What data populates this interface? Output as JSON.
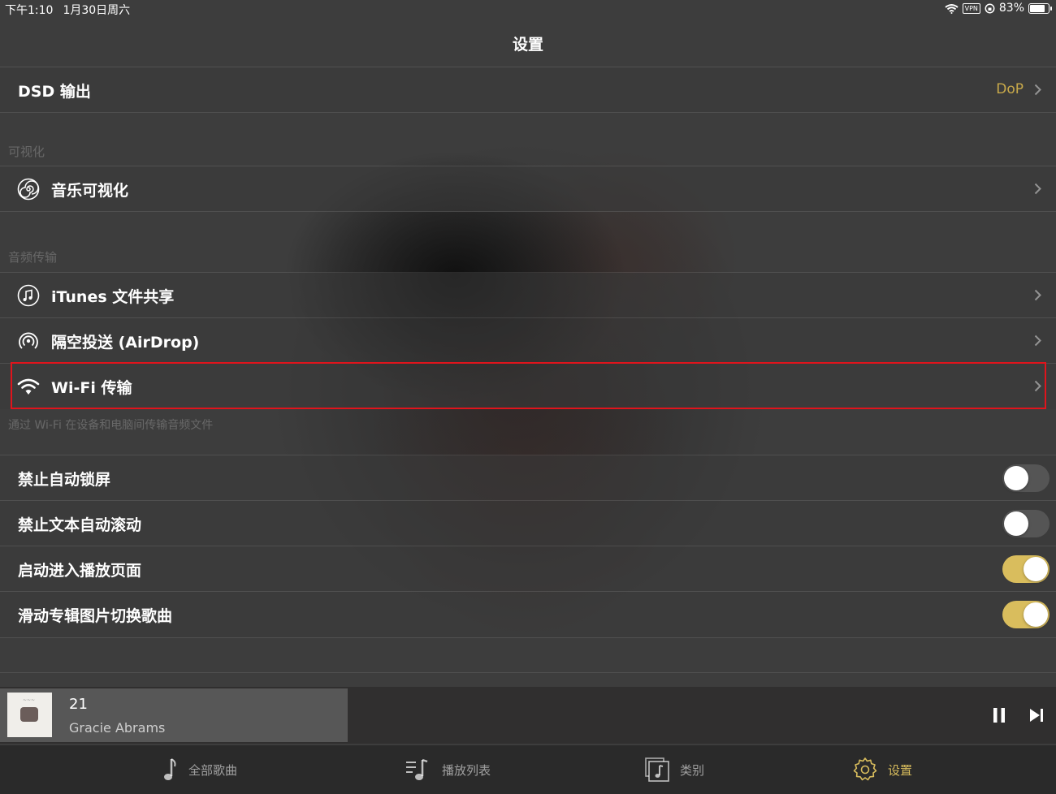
{
  "status_bar": {
    "time": "下午1:10",
    "date": "1月30日周六",
    "vpn": "VPN",
    "battery": "83%"
  },
  "nav": {
    "title": "设置"
  },
  "rows": {
    "dsd": {
      "label": "DSD 输出",
      "value": "DoP"
    },
    "visualization": {
      "label": "音乐可视化"
    },
    "itunes": {
      "label": "iTunes 文件共享"
    },
    "airdrop": {
      "label": "隔空投送 (AirDrop)"
    },
    "wifi": {
      "label": "Wi-Fi 传输"
    },
    "no_autolock": {
      "label": "禁止自动锁屏",
      "on": false
    },
    "no_autoscroll": {
      "label": "禁止文本自动滚动",
      "on": false
    },
    "launch_player": {
      "label": "启动进入播放页面",
      "on": true
    },
    "swipe_art": {
      "label": "滑动专辑图片切换歌曲",
      "on": true
    }
  },
  "sections": {
    "visualization_header": "可视化",
    "transfer_header": "音频传输",
    "transfer_footer": "通过 Wi-Fi 在设备和电脑间传输音频文件"
  },
  "player": {
    "title": "21",
    "artist": "Gracie Abrams"
  },
  "tabs": [
    {
      "label": "全部歌曲",
      "icon": "music-note-icon"
    },
    {
      "label": "播放列表",
      "icon": "playlist-icon"
    },
    {
      "label": "类别",
      "icon": "category-icon"
    },
    {
      "label": "设置",
      "icon": "gear-icon",
      "active": true
    }
  ],
  "colors": {
    "accent": "#d9bd5d",
    "highlight": "#e0141c",
    "detail": "#c8a94a"
  }
}
